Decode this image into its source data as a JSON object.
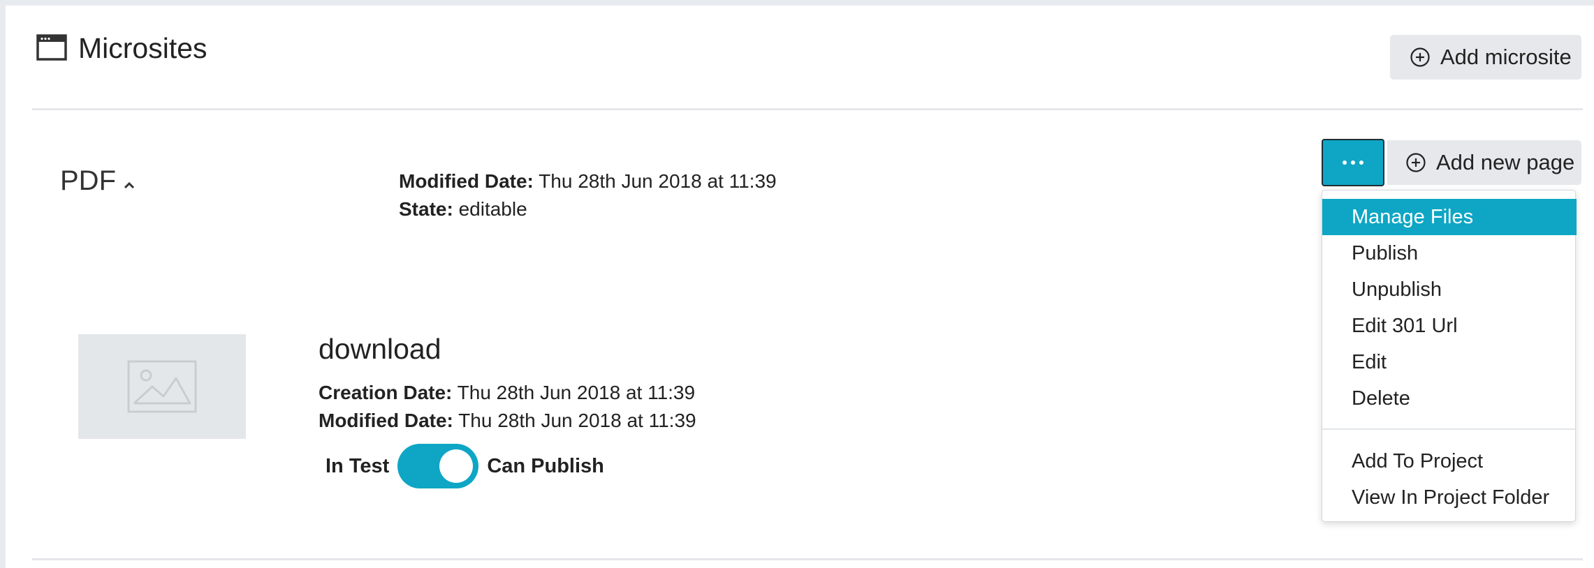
{
  "header": {
    "title": "Microsites",
    "icon": "browser-window-icon",
    "add_microsite_label": "Add microsite"
  },
  "microsite": {
    "name": "PDF",
    "modified_label": "Modified Date:",
    "modified_value": "Thu 28th Jun 2018 at 11:39",
    "state_label": "State:",
    "state_value": "editable",
    "add_page_label": "Add new page"
  },
  "menu": {
    "items": [
      "Manage Files",
      "Publish",
      "Unpublish",
      "Edit 301 Url",
      "Edit",
      "Delete",
      "Add To Project",
      "View In Project Folder"
    ],
    "active": "Manage Files"
  },
  "page": {
    "name": "download",
    "creation_label": "Creation Date:",
    "creation_value": "Thu 28th Jun 2018 at 11:39",
    "modified_label": "Modified Date:",
    "modified_value": "Thu 28th Jun 2018 at 11:39",
    "toggle_left_label": "In Test",
    "toggle_right_label": "Can Publish",
    "toggle_on": true
  },
  "colors": {
    "accent": "#0ea6c4",
    "button_bg": "#e6e8eb",
    "thumb_bg": "#e4e7ea"
  }
}
